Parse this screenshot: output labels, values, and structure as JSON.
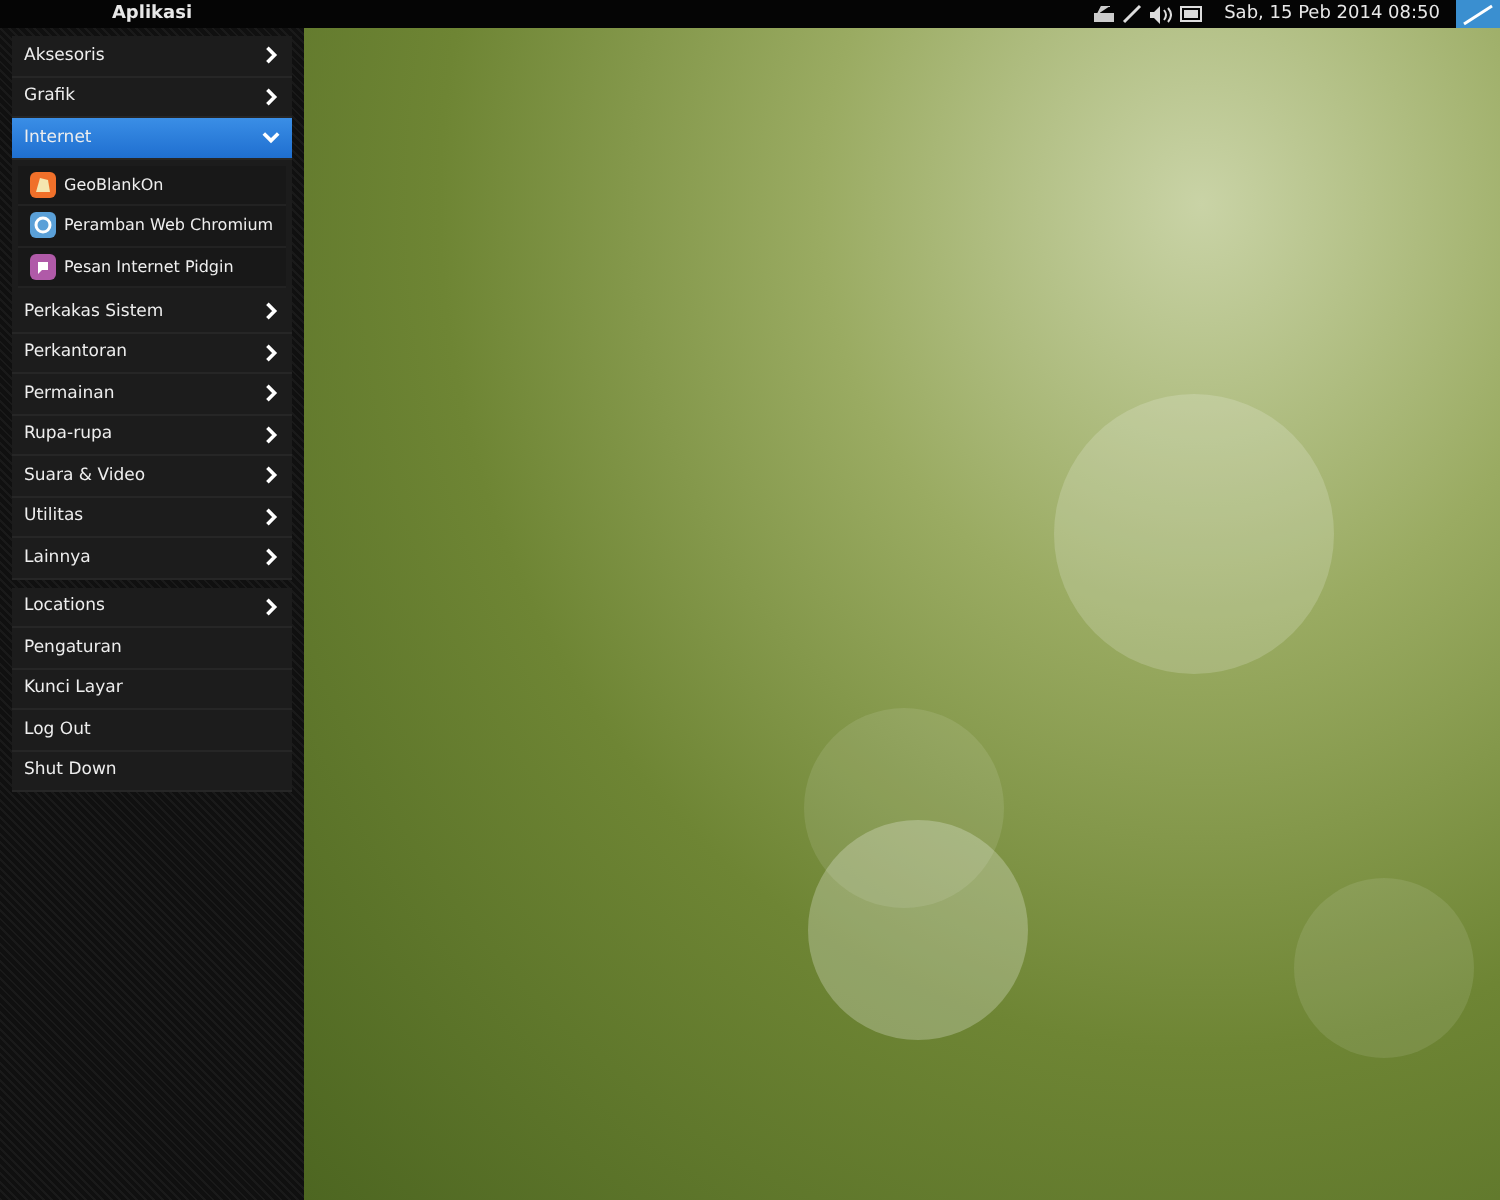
{
  "top_bar": {
    "title": "Aplikasi",
    "clock": "Sab, 15 Peb 2014 08:50"
  },
  "categories": [
    {
      "label": "Aksesoris",
      "expanded": false
    },
    {
      "label": "Grafik",
      "expanded": false
    },
    {
      "label": "Internet",
      "expanded": true,
      "children": [
        {
          "label": "GeoBlankOn",
          "kind": "map"
        },
        {
          "label": "Peramban Web Chromium",
          "kind": "browser"
        },
        {
          "label": "Pesan Internet Pidgin",
          "kind": "chat"
        }
      ]
    },
    {
      "label": "Perkakas Sistem",
      "expanded": false
    },
    {
      "label": "Perkantoran",
      "expanded": false
    },
    {
      "label": "Permainan",
      "expanded": false
    },
    {
      "label": "Rupa-rupa",
      "expanded": false
    },
    {
      "label": "Suara & Video",
      "expanded": false
    },
    {
      "label": "Utilitas",
      "expanded": false
    },
    {
      "label": "Lainnya",
      "expanded": false
    }
  ],
  "system_items": [
    {
      "label": "Locations",
      "submenu": true
    },
    {
      "label": "Pengaturan",
      "submenu": false
    },
    {
      "label": "Kunci Layar",
      "submenu": false
    },
    {
      "label": "Log Out",
      "submenu": false
    },
    {
      "label": "Shut Down",
      "submenu": false
    }
  ]
}
